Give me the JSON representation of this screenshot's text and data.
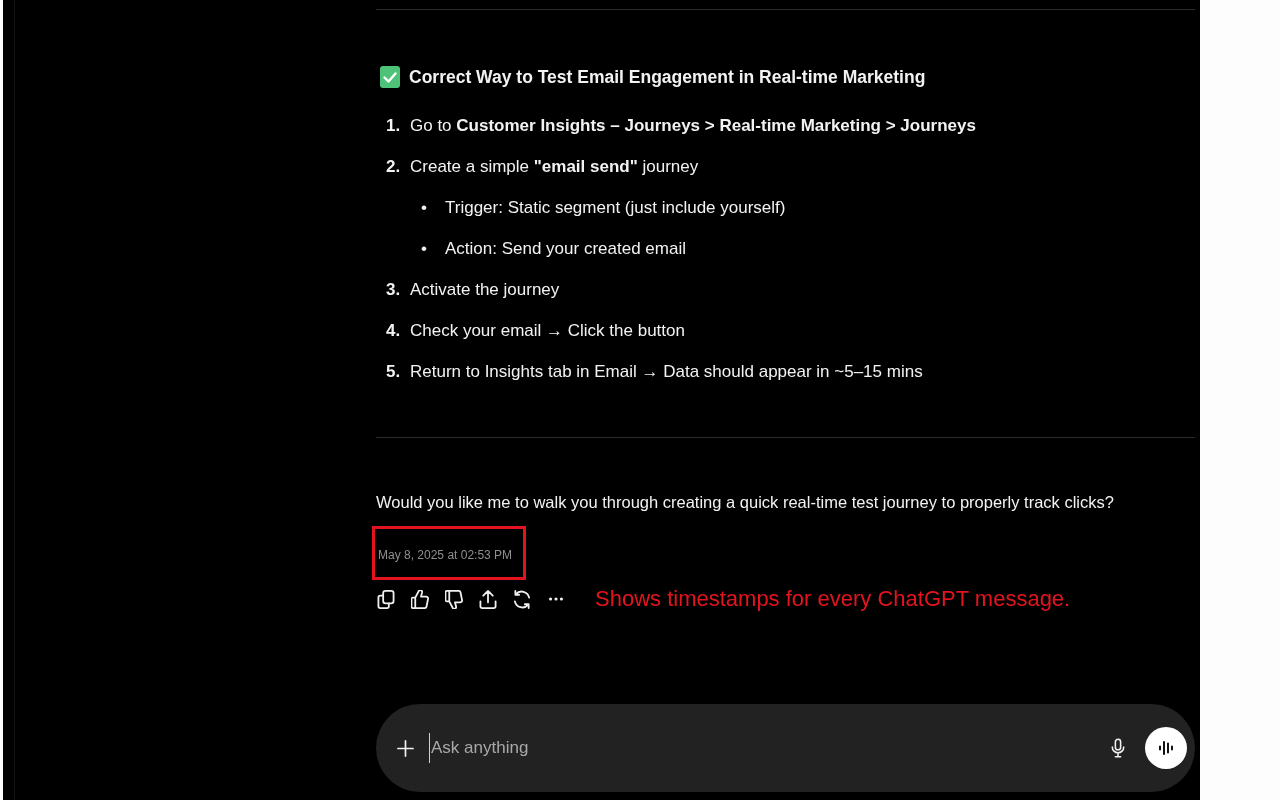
{
  "conversation": {
    "heading": {
      "text": "Correct Way to Test Email Engagement in Real-time Marketing"
    },
    "steps": [
      {
        "marker": "1.",
        "text": "Go to **Customer Insights – Journeys > Real-time Marketing > Journeys**"
      },
      {
        "marker": "2.",
        "text": "Create a simple **\"email send\"** journey",
        "children": [
          {
            "marker": "•",
            "text": "Trigger: Static segment (just include yourself)"
          },
          {
            "marker": "•",
            "text": "Action: Send your created email"
          }
        ]
      },
      {
        "marker": "3.",
        "text": "Activate the journey"
      },
      {
        "marker": "4.",
        "text": "Check your email → Click the button"
      },
      {
        "marker": "5.",
        "text": "Return to Insights tab in Email → Data should appear in ~5–15 mins"
      }
    ],
    "follow_up": "Would you like me to walk you through creating a quick real-time test journey to properly track clicks?",
    "timestamp": {
      "text": "May 8, 2025 at 02:53 PM",
      "highlighted": true
    }
  },
  "annotation": {
    "text": "Shows timestamps for every ChatGPT message."
  },
  "composer": {
    "placeholder": "Ask anything"
  }
}
